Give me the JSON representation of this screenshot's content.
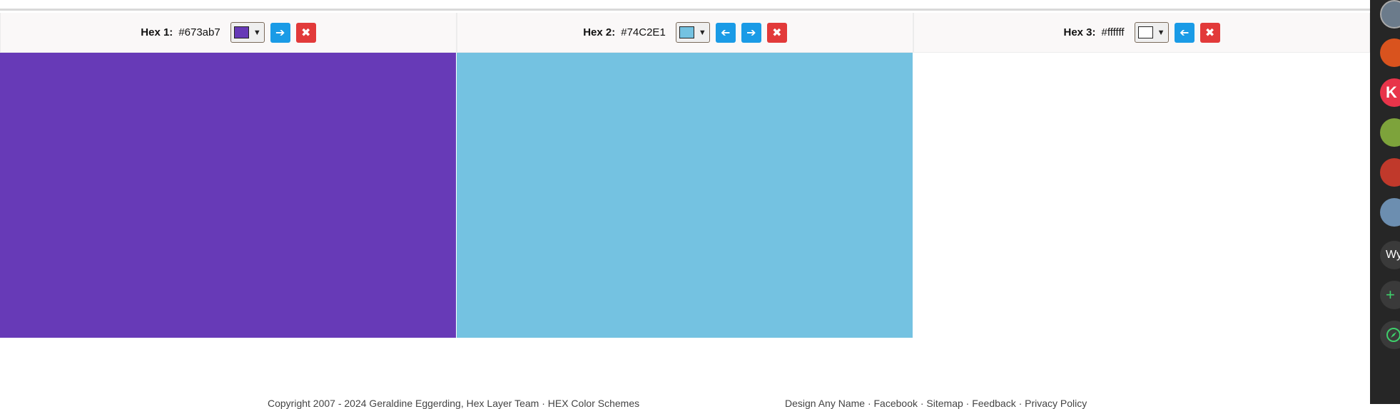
{
  "panels": [
    {
      "label": "Hex 1:",
      "value": "#673ab7",
      "color": "#673ab7",
      "has_left": false,
      "has_right": true
    },
    {
      "label": "Hex 2:",
      "value": "#74C2E1",
      "color": "#74c2e1",
      "has_left": true,
      "has_right": true
    },
    {
      "label": "Hex 3:",
      "value": "#ffffff",
      "color": "#ffffff",
      "has_left": true,
      "has_right": false
    }
  ],
  "buttons": {
    "left_icon": "arrow-left-icon",
    "right_icon": "arrow-right-icon",
    "remove_icon": "close-icon"
  },
  "footer": {
    "left_text": "Copyright 2007 - 2024 Geraldine Eggerding, Hex Layer Team · HEX Color Schemes",
    "right_text": "Design Any Name · Facebook · Sitemap · Feedback · Privacy Policy"
  },
  "sidebar": {
    "items": [
      {
        "icon": "profile-avatar-icon",
        "text": "",
        "color": "#6b7b8b"
      },
      {
        "icon": "app-avatar-orange-icon",
        "text": "",
        "color": "#d9531e"
      },
      {
        "icon": "k-letter-avatar-icon",
        "text": "K",
        "color": "#e8344a"
      },
      {
        "icon": "bamboo-avatar-icon",
        "text": "",
        "color": "#7da33b"
      },
      {
        "icon": "book-avatar-icon",
        "text": "",
        "color": "#c0392b"
      },
      {
        "icon": "landscape-avatar-icon",
        "text": "",
        "color": "#6c8eb0"
      },
      {
        "icon": "workspace-avatar-icon",
        "text": "Wy",
        "color": "#3a3a3a"
      },
      {
        "icon": "add-icon",
        "text": "+",
        "color": "#3a3a3a"
      },
      {
        "icon": "compass-icon",
        "text": "",
        "color": "#3a3a3a"
      }
    ]
  }
}
